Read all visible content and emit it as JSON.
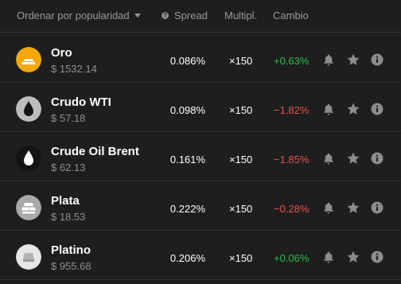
{
  "header": {
    "sort_label": "Ordenar por popularidad",
    "spread_label": "Spread",
    "multiplier_label": "Multipl.",
    "change_label": "Cambio"
  },
  "colors": {
    "positive": "#27c14a",
    "negative": "#e8524f",
    "icon": "#8c8c8c"
  },
  "assets": [
    {
      "name": "Oro",
      "price": "$ 1532.14",
      "spread": "0.086%",
      "multiplier": "×150",
      "change": "+0.63%",
      "direction": "up",
      "icon": "gold-bars-icon"
    },
    {
      "name": "Crudo WTI",
      "price": "$ 57.18",
      "spread": "0.098%",
      "multiplier": "×150",
      "change": "−1.82%",
      "direction": "down",
      "icon": "oil-drop-icon"
    },
    {
      "name": "Crude Oil Brent",
      "price": "$ 62.13",
      "spread": "0.161%",
      "multiplier": "×150",
      "change": "−1.85%",
      "direction": "down",
      "icon": "oil-drop-icon"
    },
    {
      "name": "Plata",
      "price": "$ 18.53",
      "spread": "0.222%",
      "multiplier": "×150",
      "change": "−0.28%",
      "direction": "down",
      "icon": "silver-bars-icon"
    },
    {
      "name": "Platino",
      "price": "$ 955.68",
      "spread": "0.206%",
      "multiplier": "×150",
      "change": "+0.06%",
      "direction": "up",
      "icon": "platinum-bar-icon"
    }
  ]
}
